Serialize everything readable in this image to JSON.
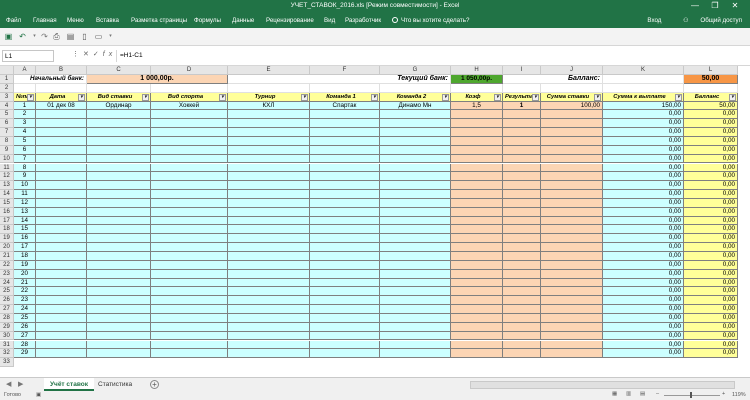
{
  "window": {
    "title": "УЧЕТ_СТАВОК_2016.xls [Режим совместимости] - Excel",
    "controls": [
      "—",
      "❐",
      "✕"
    ]
  },
  "ribbon": {
    "tabs": [
      "Файл",
      "Главная",
      "Меню",
      "Вставка",
      "Разметка страницы",
      "Формулы",
      "Данные",
      "Рецензирование",
      "Вид",
      "Разработчик"
    ],
    "tell_me": "Что вы хотите сделать?",
    "sign_in": "Вход",
    "share": "Общий доступ"
  },
  "formula_bar": {
    "name_box": "L1",
    "formula": "=H1-C1"
  },
  "columns": [
    "A",
    "B",
    "C",
    "D",
    "E",
    "F",
    "G",
    "H",
    "I",
    "J",
    "K",
    "L"
  ],
  "summary": {
    "start_bank_label": "Начальный банк:",
    "start_bank_value": "1 000,00р.",
    "current_bank_label": "Текущий банк:",
    "current_bank_value": "1 050,00р.",
    "balance_label": "Балланс:",
    "balance_value": "50,00"
  },
  "headers": [
    "№п/п",
    "Дата",
    "Вид ставки",
    "Вид спорта",
    "Турнир",
    "Команда 1",
    "Команда 2",
    "Коэф",
    "Результат",
    "Сумма ставки",
    "Сумма к выплате",
    "Балланс"
  ],
  "rows": [
    {
      "n": "1",
      "date": "01 дек 08",
      "bet_type": "Ординар",
      "sport": "Хоккей",
      "tournament": "КХЛ",
      "team1": "Спартак",
      "team2": "Динамо Мн",
      "coef": "1,5",
      "result": "1",
      "stake": "100,00",
      "payout": "150,00",
      "balance": "50,00"
    }
  ],
  "empty_row_numbers": [
    "2",
    "3",
    "4",
    "5",
    "6",
    "7",
    "8",
    "9",
    "10",
    "11",
    "12",
    "13",
    "14",
    "15",
    "16",
    "17",
    "18",
    "19",
    "20",
    "21",
    "22",
    "23",
    "24",
    "25",
    "26",
    "27",
    "28",
    "29"
  ],
  "zero_value": "0,00",
  "sheet_tabs": [
    "Учёт ставок",
    "Статистика"
  ],
  "status": {
    "ready": "Готово",
    "zoom": "119%"
  },
  "colors": {
    "excel_green": "#217346",
    "header_yellow": "#ffff99",
    "cyan_fill": "#ccffff",
    "peach_fill": "#fcd5b4",
    "orange_fill": "#f79646",
    "green_fill": "#4ea72e",
    "balance_yellow": "#ffff99"
  }
}
